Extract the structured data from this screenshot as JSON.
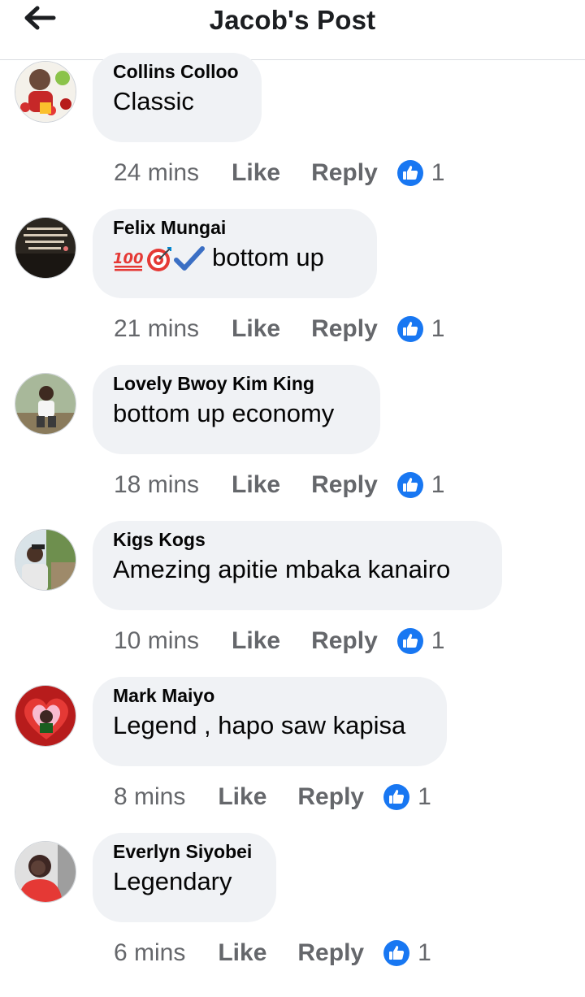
{
  "header": {
    "title": "Jacob's Post",
    "back_icon": "arrow-left-icon"
  },
  "colors": {
    "like_blue": "#1877f2",
    "bubble": "#f0f2f5",
    "meta_gray": "#65676b"
  },
  "comments": [
    {
      "author": "Collins Colloo",
      "text": "Classic",
      "time": "24 mins",
      "like": "Like",
      "reply": "Reply",
      "reactions": "1"
    },
    {
      "author": "Felix Mungai",
      "text": "bottom up",
      "emoji": [
        "hundred-points-emoji",
        "direct-hit-emoji",
        "check-mark-emoji"
      ],
      "time": "21 mins",
      "like": "Like",
      "reply": "Reply",
      "reactions": "1"
    },
    {
      "author": "Lovely Bwoy Kim King",
      "text": "bottom up economy",
      "time": "18 mins",
      "like": "Like",
      "reply": "Reply",
      "reactions": "1"
    },
    {
      "author": "Kigs Kogs",
      "text": "Amezing apitie mbaka kanairo",
      "time": "10 mins",
      "like": "Like",
      "reply": "Reply",
      "reactions": "1"
    },
    {
      "author": "Mark Maiyo",
      "text": "Legend , hapo saw kapisa",
      "time": "8 mins",
      "like": "Like",
      "reply": "Reply",
      "reactions": "1"
    },
    {
      "author": "Everlyn Siyobei",
      "text": "Legendary",
      "time": "6 mins",
      "like": "Like",
      "reply": "Reply",
      "reactions": "1"
    }
  ]
}
